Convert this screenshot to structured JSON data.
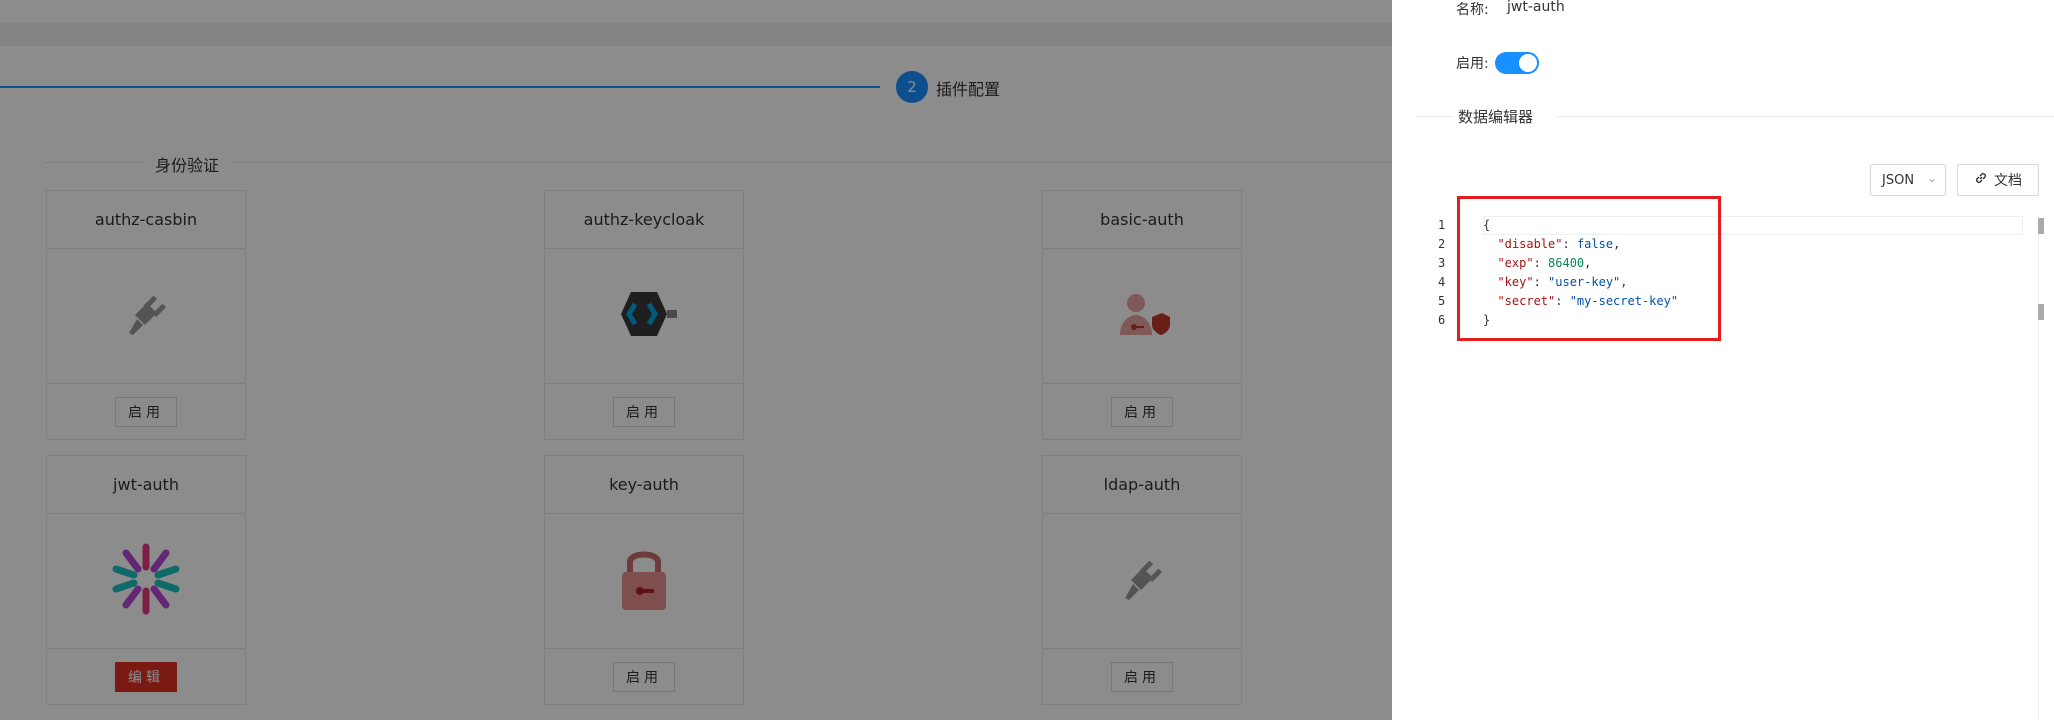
{
  "steps": {
    "current_number": "2",
    "current_title": "插件配置"
  },
  "section": {
    "title": "身份验证"
  },
  "plugins": [
    {
      "name": "authz-casbin",
      "icon": "plug-icon",
      "button": "启用"
    },
    {
      "name": "authz-keycloak",
      "icon": "keycloak-logo-icon",
      "button": "启用"
    },
    {
      "name": "basic-auth",
      "icon": "user-shield-icon",
      "button": "启用"
    },
    {
      "name": "jwt-auth",
      "icon": "jwt-logo-icon",
      "button": "编辑"
    },
    {
      "name": "key-auth",
      "icon": "padlock-icon",
      "button": "启用"
    },
    {
      "name": "ldap-auth",
      "icon": "plug-icon",
      "button": "启用"
    }
  ],
  "drawer": {
    "name_label": "名称:",
    "name_value": "jwt-auth",
    "enable_label": "启用:",
    "enabled": true,
    "editor_title": "数据编辑器",
    "format_select": "JSON",
    "doc_button": "文档",
    "code_lines": [
      {
        "num": "1",
        "text": "{"
      },
      {
        "num": "2",
        "key": "\"disable\"",
        "value": "false",
        "vtype": "bool",
        "trail": ","
      },
      {
        "num": "3",
        "key": "\"exp\"",
        "value": "86400",
        "vtype": "num",
        "trail": ","
      },
      {
        "num": "4",
        "key": "\"key\"",
        "value": "\"user-key\"",
        "vtype": "str",
        "trail": ","
      },
      {
        "num": "5",
        "key": "\"secret\"",
        "value": "\"my-secret-key\"",
        "vtype": "str",
        "trail": ""
      },
      {
        "num": "6",
        "text": "}"
      }
    ]
  },
  "colors": {
    "primary": "#1890ff",
    "danger": "#e02e24",
    "highlight": "#e41e1e"
  }
}
